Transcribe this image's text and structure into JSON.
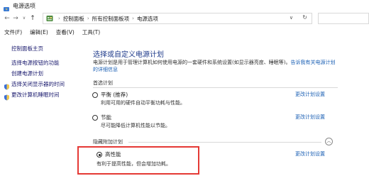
{
  "window": {
    "title": "电源选项"
  },
  "address": {
    "crumbs": [
      "控制面板",
      "所有控制面板项",
      "电源选项"
    ],
    "back_glyph": "←",
    "forward_glyph": "→",
    "recent_glyph": "∨",
    "up_glyph": "↑",
    "dropdown_glyph": "∨",
    "refresh_glyph": "↻"
  },
  "menu": [
    "文件(F)",
    "编辑(E)",
    "查看(V)",
    "工具(T)"
  ],
  "sidebar": {
    "home": "控制面板主页",
    "links": [
      "选择电源按钮的功能",
      "创建电源计划",
      "选择关闭显示器的时间",
      "更改计算机睡眠时间"
    ]
  },
  "main": {
    "title": "选择或自定义电源计划",
    "desc_line1": "电源计划是用于管理计算机如何使用电源的一套硬件和系统设置(如显示器亮度、睡眠等)。",
    "desc_link_a": "告诉我有关电源计划",
    "desc_link_b": "的详细信息",
    "preferred_label": "首选计划",
    "hidden_label": "隐藏附加计划",
    "collapse_glyph": "︿",
    "plans": [
      {
        "name": "平衡 (推荐)",
        "desc": "利用可用的硬件自动平衡功耗与性能。",
        "link": "更改计划设置",
        "selected": false
      },
      {
        "name": "节能",
        "desc": "尽可能降低计算机性能以节能。",
        "link": "更改计划设置",
        "selected": false
      },
      {
        "name": "高性能",
        "desc": "有利于提高性能，但会增加功耗。",
        "link": "更改计划设置",
        "selected": true
      }
    ]
  },
  "colors": {
    "highlight": "#e53935",
    "link": "#1a5fb4",
    "title": "#1e3a8a"
  }
}
